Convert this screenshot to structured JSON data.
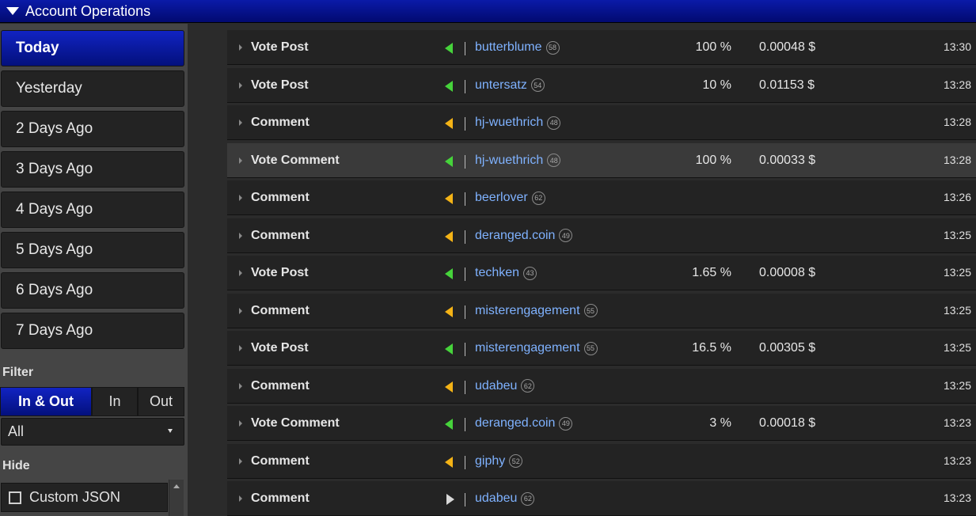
{
  "header": {
    "title": "Account Operations"
  },
  "sidebar": {
    "days": [
      {
        "label": "Today",
        "active": true
      },
      {
        "label": "Yesterday",
        "active": false
      },
      {
        "label": "2 Days Ago",
        "active": false
      },
      {
        "label": "3 Days Ago",
        "active": false
      },
      {
        "label": "4 Days Ago",
        "active": false
      },
      {
        "label": "5 Days Ago",
        "active": false
      },
      {
        "label": "6 Days Ago",
        "active": false
      },
      {
        "label": "7 Days Ago",
        "active": false
      }
    ],
    "filter_label": "Filter",
    "filter_options": [
      {
        "label": "In & Out",
        "active": true
      },
      {
        "label": "In",
        "active": false
      },
      {
        "label": "Out",
        "active": false
      }
    ],
    "select_value": "All",
    "hide_label": "Hide",
    "hide_option": {
      "label": "Custom JSON",
      "checked": false
    }
  },
  "colors": {
    "vote_arrow": "#46d33b",
    "comment_arrow": "#f4b316",
    "outgoing_arrow": "#d8d8d8",
    "user_link": "#7fb2ff",
    "active_blue": "#0a1aa8"
  },
  "operations": [
    {
      "type": "Vote Post",
      "kind": "vote",
      "user": "butterblume",
      "rep": "58",
      "pct": "100 %",
      "value": "0.00048 $",
      "time": "13:30"
    },
    {
      "type": "Vote Post",
      "kind": "vote",
      "user": "untersatz",
      "rep": "54",
      "pct": "10 %",
      "value": "0.01153 $",
      "time": "13:28"
    },
    {
      "type": "Comment",
      "kind": "comment",
      "user": "hj-wuethrich",
      "rep": "48",
      "pct": "",
      "value": "",
      "time": "13:28"
    },
    {
      "type": "Vote Comment",
      "kind": "vote",
      "user": "hj-wuethrich",
      "rep": "48",
      "pct": "100 %",
      "value": "0.00033 $",
      "time": "13:28",
      "highlighted": true
    },
    {
      "type": "Comment",
      "kind": "comment",
      "user": "beerlover",
      "rep": "62",
      "pct": "",
      "value": "",
      "time": "13:26"
    },
    {
      "type": "Comment",
      "kind": "comment",
      "user": "deranged.coin",
      "rep": "49",
      "pct": "",
      "value": "",
      "time": "13:25"
    },
    {
      "type": "Vote Post",
      "kind": "vote",
      "user": "techken",
      "rep": "43",
      "pct": "1.65 %",
      "value": "0.00008 $",
      "time": "13:25"
    },
    {
      "type": "Comment",
      "kind": "comment",
      "user": "misterengagement",
      "rep": "55",
      "pct": "",
      "value": "",
      "time": "13:25"
    },
    {
      "type": "Vote Post",
      "kind": "vote",
      "user": "misterengagement",
      "rep": "55",
      "pct": "16.5 %",
      "value": "0.00305 $",
      "time": "13:25"
    },
    {
      "type": "Comment",
      "kind": "comment",
      "user": "udabeu",
      "rep": "62",
      "pct": "",
      "value": "",
      "time": "13:25"
    },
    {
      "type": "Vote Comment",
      "kind": "vote",
      "user": "deranged.coin",
      "rep": "49",
      "pct": "3 %",
      "value": "0.00018 $",
      "time": "13:23"
    },
    {
      "type": "Comment",
      "kind": "comment",
      "user": "giphy",
      "rep": "52",
      "pct": "",
      "value": "",
      "time": "13:23"
    },
    {
      "type": "Comment",
      "kind": "outgoing",
      "user": "udabeu",
      "rep": "62",
      "pct": "",
      "value": "",
      "time": "13:23"
    }
  ]
}
